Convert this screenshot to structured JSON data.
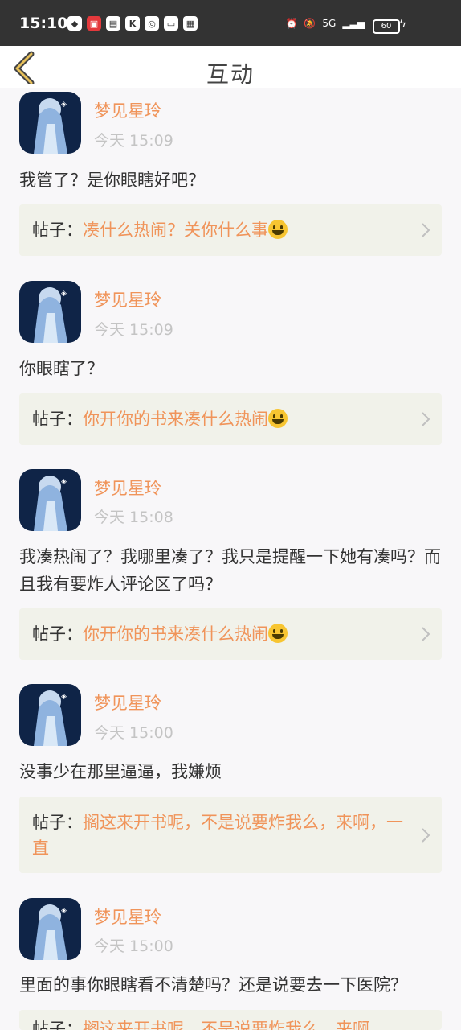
{
  "status_bar": {
    "time": "15:10",
    "battery": "60",
    "network": "5G"
  },
  "header": {
    "title": "互动"
  },
  "messages": [
    {
      "user": "梦见星玲",
      "time": "今天 15:09",
      "content": "我管了？是你眼瞎好吧？",
      "post_prefix": "帖子：",
      "post_title": "凑什么热闹？关你什么事",
      "emoji": "smiley"
    },
    {
      "user": "梦见星玲",
      "time": "今天 15:09",
      "content": "你眼瞎了？",
      "post_prefix": "帖子：",
      "post_title": "你开你的书来凑什么热闹",
      "emoji": "smiley"
    },
    {
      "user": "梦见星玲",
      "time": "今天 15:08",
      "content": "我凑热闹了？我哪里凑了？我只是提醒一下她有凑吗？而且我有要炸人评论区了吗？",
      "post_prefix": "帖子：",
      "post_title": "你开你的书来凑什么热闹",
      "emoji": "smiley"
    },
    {
      "user": "梦见星玲",
      "time": "今天 15:00",
      "content": "没事少在那里逼逼，我嫌烦",
      "post_prefix": "帖子：",
      "post_title": "搁这来开书呢，不是说要炸我么，来啊，一直",
      "emoji": ""
    },
    {
      "user": "梦见星玲",
      "time": "今天 15:00",
      "content": "里面的事你眼瞎看不清楚吗？还是说要去一下医院？",
      "post_prefix": "帖子：",
      "post_title": "搁这来开书呢，不是说要炸我么，来啊，",
      "emoji": ""
    }
  ]
}
